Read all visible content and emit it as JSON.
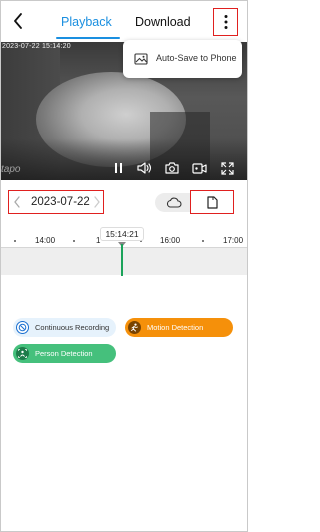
{
  "header": {
    "tabs": [
      {
        "label": "Playback",
        "active": true
      },
      {
        "label": "Download",
        "active": false
      }
    ],
    "icons": {
      "back": "chevron-left-icon",
      "more": "more-vertical-icon"
    }
  },
  "video": {
    "timestamp": "2023-07-22 15:14:20",
    "logo": "tapo",
    "controls": [
      "pause-icon",
      "volume-icon",
      "camera-icon",
      "record-icon",
      "fullscreen-icon"
    ]
  },
  "menu": {
    "item_label": "Auto-Save to Phone",
    "icon": "image-icon"
  },
  "date_bar": {
    "date": "2023-07-22",
    "icons": {
      "prev": "chevron-left-icon",
      "next": "chevron-right-icon",
      "cloud": "cloud-icon",
      "sd": "sd-card-icon"
    }
  },
  "timeline": {
    "ticks": [
      "14:00",
      "1",
      "16:00",
      "17:00"
    ],
    "current_time": "15:14:21"
  },
  "legend": [
    {
      "label": "Continuous Recording",
      "color": "#e6f2fc",
      "icon": "record-circle-icon"
    },
    {
      "label": "Motion Detection",
      "color": "#f5900a",
      "icon": "running-person-icon"
    },
    {
      "label": "Person Detection",
      "color": "#45c07c",
      "icon": "person-target-icon"
    }
  ],
  "colors": {
    "accent": "#1a8fe0",
    "highlight": "#e0201f",
    "cursor": "#1ba35a"
  }
}
